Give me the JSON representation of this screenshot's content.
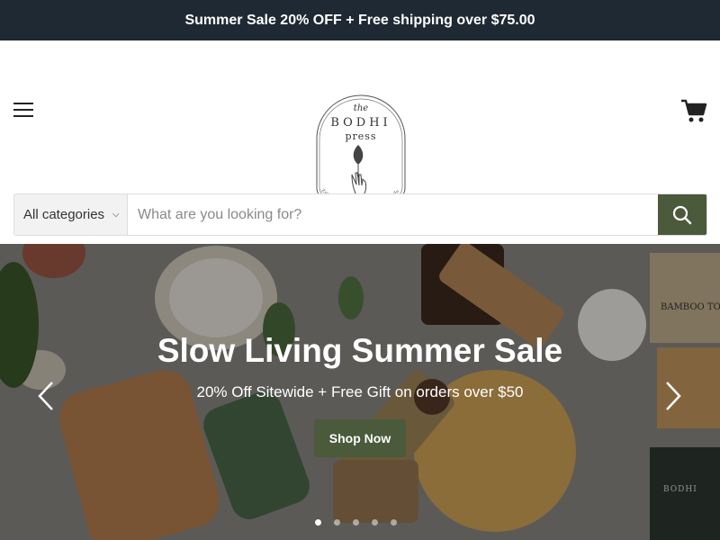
{
  "announcement": {
    "text": "Summer Sale 20% OFF + Free shipping over $75.00"
  },
  "header": {
    "menu_icon": "hamburger-menu-icon",
    "cart_icon": "shopping-cart-icon",
    "logo": {
      "the": "the",
      "name": "BODHI",
      "press": "press",
      "tagline": "Zen and Sustainable Living Made Easy"
    }
  },
  "search": {
    "category_label": "All categories",
    "placeholder": "What are you looking for?",
    "button_icon": "search-icon"
  },
  "hero": {
    "title": "Slow Living Summer Sale",
    "subtitle": "20% Off Sitewide + Free Gift on orders over $50",
    "button_label": "Shop Now",
    "slide_count": 5,
    "active_slide": 1,
    "box_label": "BAMBOO TOO",
    "card_logo": "BODHI"
  },
  "colors": {
    "announcement_bg": "#1f2933",
    "accent_green": "#4a5a3a"
  }
}
